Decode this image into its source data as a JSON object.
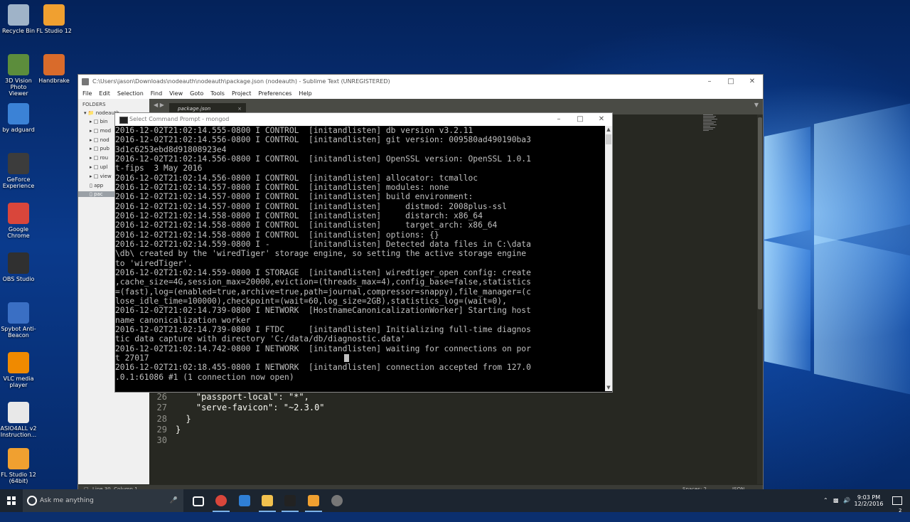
{
  "desktop": {
    "icons": [
      {
        "label": "Recycle Bin",
        "color": "#9fb3c8"
      },
      {
        "label": "FL Studio 12",
        "color": "#f0a030"
      },
      {
        "label": "3D Vision Photo Viewer",
        "color": "#5c8d3c"
      },
      {
        "label": "Handbrake",
        "color": "#d96b2b"
      },
      {
        "label": "by adguard",
        "color": "#3b82d6"
      },
      {
        "label": "GeForce Experience",
        "color": "#3c3c3c"
      },
      {
        "label": "Google Chrome",
        "color": "#d9463b"
      },
      {
        "label": "OBS Studio",
        "color": "#303030"
      },
      {
        "label": "Spybot Anti-Beacon",
        "color": "#3a6fc4"
      },
      {
        "label": "VLC media player",
        "color": "#f08a00"
      },
      {
        "label": "ASIO4ALL v2 Instruction...",
        "color": "#e8e8e8"
      },
      {
        "label": "FL Studio 12 (64bit)",
        "color": "#f0a030"
      }
    ]
  },
  "sublime": {
    "title": "C:\\Users\\jason\\Downloads\\nodeauth\\nodeauth\\package.json (nodeauth) - Sublime Text (UNREGISTERED)",
    "menu": [
      "File",
      "Edit",
      "Selection",
      "Find",
      "View",
      "Goto",
      "Tools",
      "Project",
      "Preferences",
      "Help"
    ],
    "sidebar": {
      "header": "FOLDERS",
      "root": "nodeauth",
      "items": [
        "bin",
        "mod",
        "nod",
        "pub",
        "rou",
        "upl",
        "view",
        "app",
        "pac"
      ]
    },
    "tab_label": "package.json",
    "code_lines": [
      {
        "num": "26",
        "text": "    \"passport-local\": \"*\","
      },
      {
        "num": "27",
        "text": "    \"serve-favicon\": \"~2.3.0\""
      },
      {
        "num": "28",
        "text": "  }"
      },
      {
        "num": "29",
        "text": "}"
      },
      {
        "num": "30",
        "text": ""
      }
    ],
    "status_left": "Line 30, Column 1",
    "status_spaces": "Spaces: 2",
    "status_syntax": "JSON"
  },
  "cmd": {
    "title": "Select Command Prompt - mongod",
    "lines": [
      "2016-12-02T21:02:14.555-0800 I CONTROL  [initandlisten] db version v3.2.11",
      "2016-12-02T21:02:14.556-0800 I CONTROL  [initandlisten] git version: 009580ad490190ba3",
      "3d1c6253ebd8d91808923e4",
      "2016-12-02T21:02:14.556-0800 I CONTROL  [initandlisten] OpenSSL version: OpenSSL 1.0.1",
      "t-fips  3 May 2016",
      "2016-12-02T21:02:14.556-0800 I CONTROL  [initandlisten] allocator: tcmalloc",
      "2016-12-02T21:02:14.557-0800 I CONTROL  [initandlisten] modules: none",
      "2016-12-02T21:02:14.557-0800 I CONTROL  [initandlisten] build environment:",
      "2016-12-02T21:02:14.557-0800 I CONTROL  [initandlisten]     distmod: 2008plus-ssl",
      "2016-12-02T21:02:14.558-0800 I CONTROL  [initandlisten]     distarch: x86_64",
      "2016-12-02T21:02:14.558-0800 I CONTROL  [initandlisten]     target_arch: x86_64",
      "2016-12-02T21:02:14.558-0800 I CONTROL  [initandlisten] options: {}",
      "2016-12-02T21:02:14.559-0800 I -        [initandlisten] Detected data files in C:\\data",
      "\\db\\ created by the 'wiredTiger' storage engine, so setting the active storage engine",
      "to 'wiredTiger'.",
      "2016-12-02T21:02:14.559-0800 I STORAGE  [initandlisten] wiredtiger_open config: create",
      ",cache_size=4G,session_max=20000,eviction=(threads_max=4),config_base=false,statistics",
      "=(fast),log=(enabled=true,archive=true,path=journal,compressor=snappy),file_manager=(c",
      "lose_idle_time=100000),checkpoint=(wait=60,log_size=2GB),statistics_log=(wait=0),",
      "2016-12-02T21:02:14.739-0800 I NETWORK  [HostnameCanonicalizationWorker] Starting host",
      "name canonicalization worker",
      "2016-12-02T21:02:14.739-0800 I FTDC     [initandlisten] Initializing full-time diagnos",
      "tic data capture with directory 'C:/data/db/diagnostic.data'",
      "2016-12-02T21:02:14.742-0800 I NETWORK  [initandlisten] waiting for connections on por",
      "t 27017",
      "2016-12-02T21:02:18.455-0800 I NETWORK  [initandlisten] connection accepted from 127.0",
      ".0.1:61086 #1 (1 connection now open)"
    ]
  },
  "taskbar": {
    "search_placeholder": "Ask me anything",
    "apps": [
      {
        "name": "task-view",
        "color": "#ffffff"
      },
      {
        "name": "chrome",
        "color": "#d9463b"
      },
      {
        "name": "edge",
        "color": "#2f7fd6"
      },
      {
        "name": "file-explorer",
        "color": "#f2c14e"
      },
      {
        "name": "command-prompt",
        "color": "#222222"
      },
      {
        "name": "sublime-text",
        "color": "#f0a030"
      },
      {
        "name": "obs",
        "color": "#777777"
      }
    ],
    "time": "9:03 PM",
    "date": "12/2/2016",
    "notification_count": "2"
  }
}
